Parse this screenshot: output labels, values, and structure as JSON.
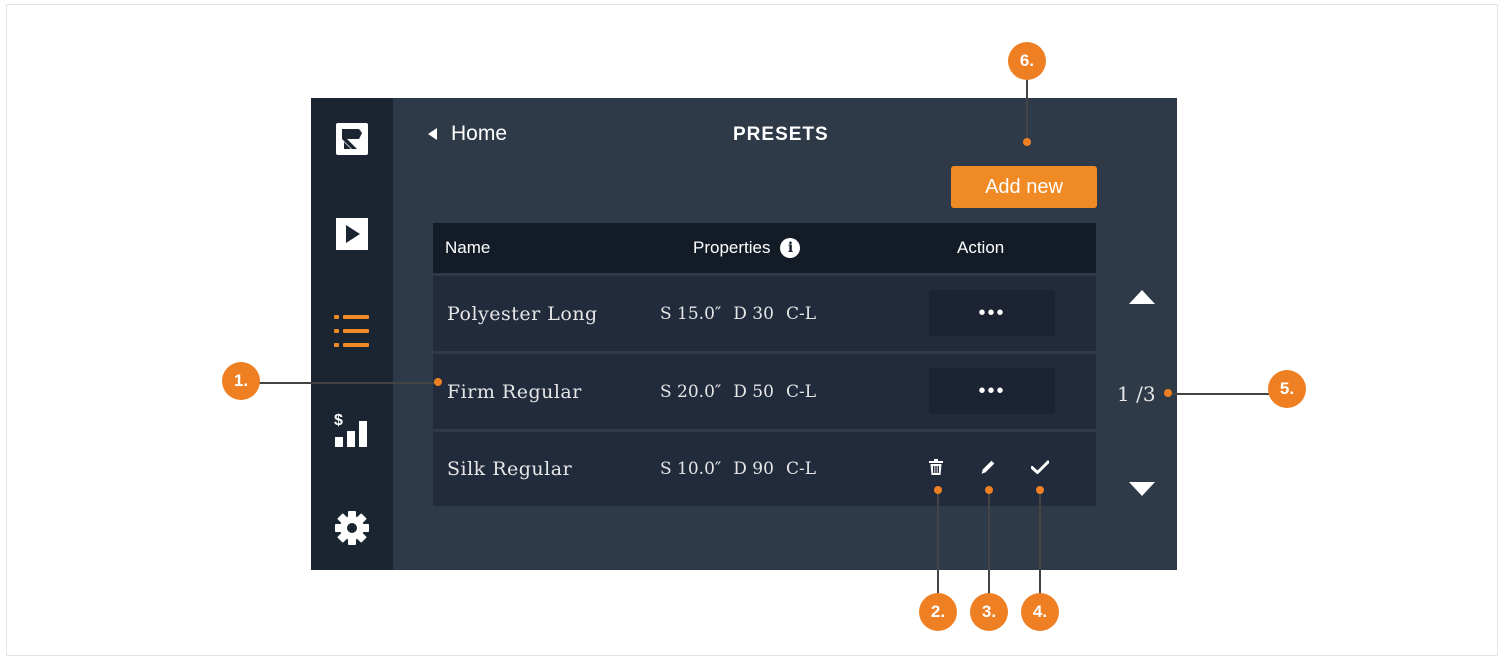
{
  "header": {
    "back_label": "Home",
    "title": "PRESETS",
    "add_button_label": "Add new"
  },
  "sidebar": {
    "items": [
      {
        "icon": "logo-icon"
      },
      {
        "icon": "play-icon"
      },
      {
        "icon": "list-icon",
        "active": true
      },
      {
        "icon": "sales-chart-icon"
      },
      {
        "icon": "gear-icon"
      }
    ]
  },
  "table": {
    "columns": [
      "Name",
      "Properties",
      "Action"
    ],
    "info_glyph": "i",
    "rows": [
      {
        "name": "Polyester Long",
        "s": "S 15.0″",
        "d": "D 30",
        "c": "C-L",
        "action": "•••"
      },
      {
        "name": "Firm Regular",
        "s": "S 20.0″",
        "d": "D 50",
        "c": "C-L",
        "action": "•••"
      },
      {
        "name": "Silk Regular",
        "s": "S 10.0″",
        "d": "D 90",
        "c": "C-L",
        "action": "icons"
      }
    ]
  },
  "pager": {
    "text": "1 /3"
  },
  "callouts": [
    "1.",
    "2.",
    "3.",
    "4.",
    "5.",
    "6."
  ],
  "colors": {
    "accent": "#f08a24",
    "background": "#2f3a48",
    "sidebar": "#1b2431",
    "row": "#222b3c",
    "header_row": "#131b26"
  }
}
